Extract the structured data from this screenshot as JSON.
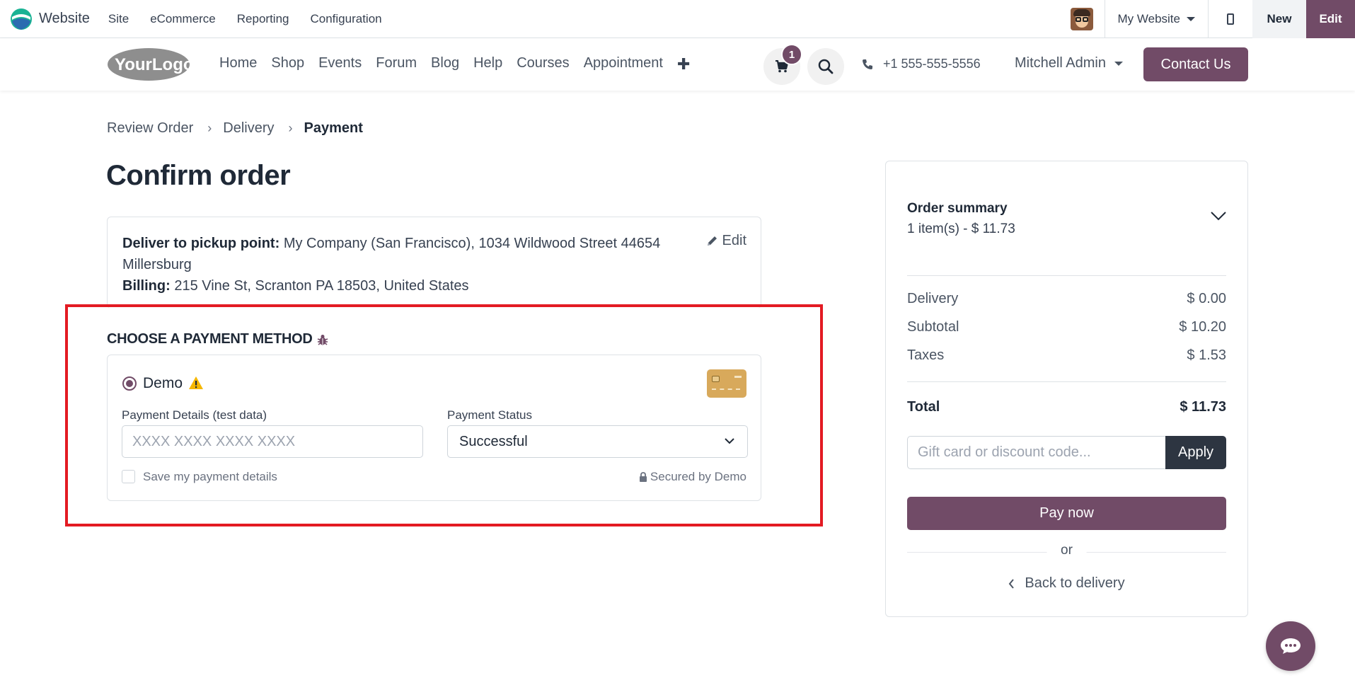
{
  "admin": {
    "app_name": "Website",
    "menu": [
      "Site",
      "eCommerce",
      "Reporting",
      "Configuration"
    ],
    "site_switch": "My Website",
    "new_label": "New",
    "edit_label": "Edit"
  },
  "header": {
    "logo_text": "YourLogo",
    "nav": [
      "Home",
      "Shop",
      "Events",
      "Forum",
      "Blog",
      "Help",
      "Courses",
      "Appointment"
    ],
    "cart_count": "1",
    "phone": "+1 555-555-5556",
    "user": "Mitchell Admin",
    "contact_label": "Contact Us"
  },
  "breadcrumb": {
    "step1": "Review Order",
    "step2": "Delivery",
    "step3": "Payment"
  },
  "page_title": "Confirm order",
  "address": {
    "delivery_label": "Deliver to pickup point:",
    "delivery_value": "My Company (San Francisco), 1034 Wildwood Street 44654",
    "delivery_value_2": "Millersburg",
    "billing_label": "Billing:",
    "billing_value": "215 Vine St, Scranton PA 18503, United States",
    "edit_label": "Edit"
  },
  "payment": {
    "title": "CHOOSE A PAYMENT METHOD",
    "method_name": "Demo",
    "details_label": "Payment Details (test data)",
    "details_placeholder": "XXXX XXXX XXXX XXXX",
    "status_label": "Payment Status",
    "status_value": "Successful",
    "save_label": "Save my payment details",
    "secured_label": "Secured by Demo"
  },
  "summary": {
    "title": "Order summary",
    "subtitle": "1 item(s) -  $ 11.73",
    "delivery_label": "Delivery",
    "delivery_value": "$ 0.00",
    "subtotal_label": "Subtotal",
    "subtotal_value": "$ 10.20",
    "taxes_label": "Taxes",
    "taxes_value": "$ 1.53",
    "total_label": "Total",
    "total_value": "$ 11.73",
    "promo_placeholder": "Gift card or discount code...",
    "apply_label": "Apply",
    "pay_label": "Pay now",
    "or_label": "or",
    "back_label": "Back to delivery"
  },
  "colors": {
    "brand": "#714b67",
    "highlight": "#e31b23",
    "dark_button": "#2d3541"
  }
}
